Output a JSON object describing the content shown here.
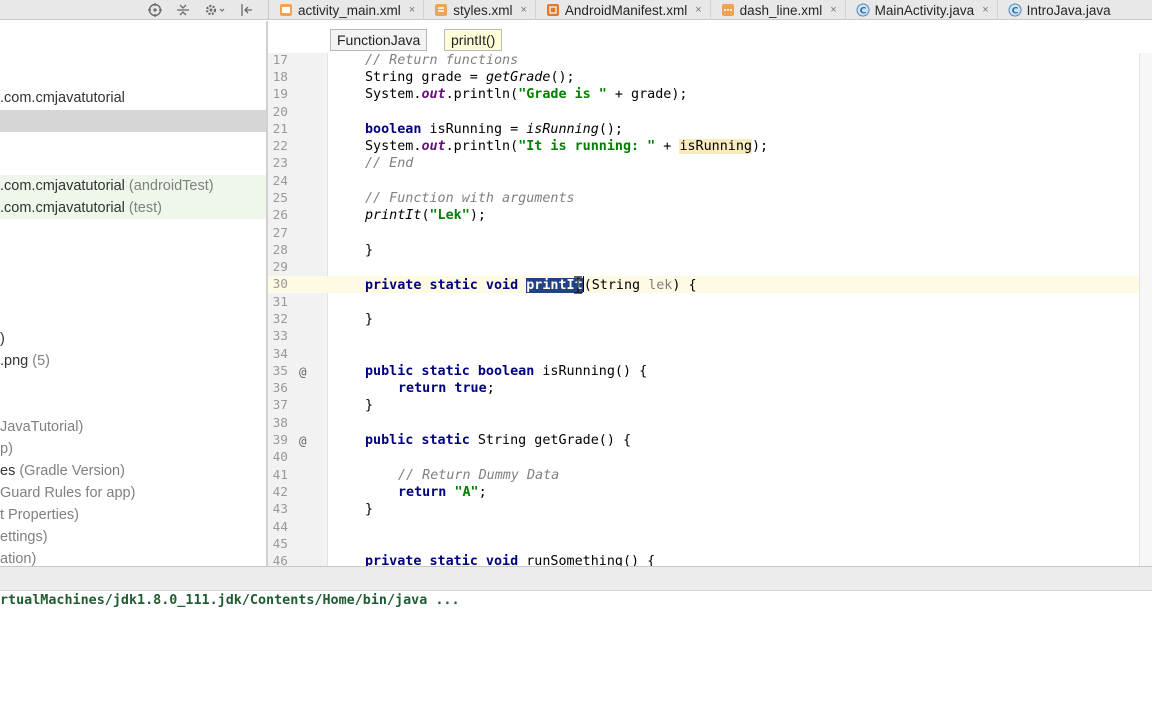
{
  "top_tabs": [
    {
      "label": "activity_main.xml",
      "icon": "xml-layout-icon"
    },
    {
      "label": "styles.xml",
      "icon": "xml-values-icon"
    },
    {
      "label": "AndroidManifest.xml",
      "icon": "manifest-icon"
    },
    {
      "label": "dash_line.xml",
      "icon": "xml-drawable-icon"
    },
    {
      "label": "MainActivity.java",
      "icon": "java-class-icon"
    },
    {
      "label": "IntroJava.java",
      "icon": "java-class-icon"
    }
  ],
  "tab_close_glyph": "×",
  "project_tree": [
    {
      "label": ".com.cmjavatutorial",
      "sub": ""
    },
    {
      "label": ".com.cmjavatutorial",
      "sub": " (androidTest)"
    },
    {
      "label": ".com.cmjavatutorial",
      "sub": " (test)"
    },
    {
      "label": ")",
      "sub": ""
    },
    {
      "label": ".png",
      "sub": " (5)"
    },
    {
      "label": "",
      "sub": "JavaTutorial)"
    },
    {
      "label": "",
      "sub": "p)"
    },
    {
      "label": "es",
      "sub": " (Gradle Version)"
    },
    {
      "label": "",
      "sub": "Guard Rules for app)"
    },
    {
      "label": "",
      "sub": "t Properties)"
    },
    {
      "label": "",
      "sub": "ettings)"
    },
    {
      "label": "",
      "sub": "ation)"
    }
  ],
  "breadcrumb": [
    "FunctionJava",
    "printIt()"
  ],
  "code": {
    "l17": {
      "n": "17",
      "cmt": "// Return functions"
    },
    "l18": {
      "n": "18",
      "a": "String grade = ",
      "b": "getGrade",
      "c": "();"
    },
    "l19": {
      "n": "19",
      "a": "System.",
      "fld": "out",
      "b": ".println(",
      "str": "\"Grade is \"",
      "c": " + grade);"
    },
    "l20": {
      "n": "20"
    },
    "l21": {
      "n": "21",
      "kw": "boolean",
      "a": " isRunning = ",
      "b": "isRunning",
      "c": "();"
    },
    "l22": {
      "n": "22",
      "a": "System.",
      "fld": "out",
      "b": ".println(",
      "str": "\"It is running: \"",
      "c": " + ",
      "d": "isRunning",
      "e": ");"
    },
    "l23": {
      "n": "23",
      "cmt": "// End"
    },
    "l24": {
      "n": "24"
    },
    "l25": {
      "n": "25",
      "cmt": "// Function with arguments"
    },
    "l26": {
      "n": "26",
      "a": "printIt",
      "b": "(",
      "str": "\"Lek\"",
      "c": ");"
    },
    "l27": {
      "n": "27"
    },
    "l28": {
      "n": "28",
      "a": "}"
    },
    "l29": {
      "n": "29"
    },
    "l30": {
      "n": "30",
      "kw": "private static void",
      "sel": "printIt",
      "c": "(String ",
      "unused": "lek",
      "d": ") {"
    },
    "l31": {
      "n": "31"
    },
    "l32": {
      "n": "32",
      "a": "}"
    },
    "l33": {
      "n": "33"
    },
    "l34": {
      "n": "34"
    },
    "l35": {
      "n": "35",
      "mark": "@",
      "kw": "public static boolean",
      "a": " isRunning() {"
    },
    "l36": {
      "n": "36",
      "kw": "return true",
      "a": ";"
    },
    "l37": {
      "n": "37",
      "a": "}"
    },
    "l38": {
      "n": "38"
    },
    "l39": {
      "n": "39",
      "mark": "@",
      "kw": "public static",
      "a": " String getGrade() {"
    },
    "l40": {
      "n": "40"
    },
    "l41": {
      "n": "41",
      "cmt": "// Return Dummy Data"
    },
    "l42": {
      "n": "42",
      "kw": "return",
      "a": " ",
      "str": "\"A\"",
      "c": ";"
    },
    "l43": {
      "n": "43",
      "a": "}"
    },
    "l44": {
      "n": "44"
    },
    "l45": {
      "n": "45"
    },
    "l46": {
      "n": "46",
      "kw": "private static void",
      "a": " runSomething() {"
    }
  },
  "console": {
    "line": "rtualMachines/jdk1.8.0_111.jdk/Contents/Home/bin/java ..."
  },
  "colors": {
    "keyword": "#000080",
    "string": "#008000",
    "comment": "#808080",
    "static_field": "#660e7a",
    "selection": "#214283",
    "usage_highlight": "#f9ebbe",
    "current_line": "#fffae3",
    "console_text": "#1f5c32"
  }
}
